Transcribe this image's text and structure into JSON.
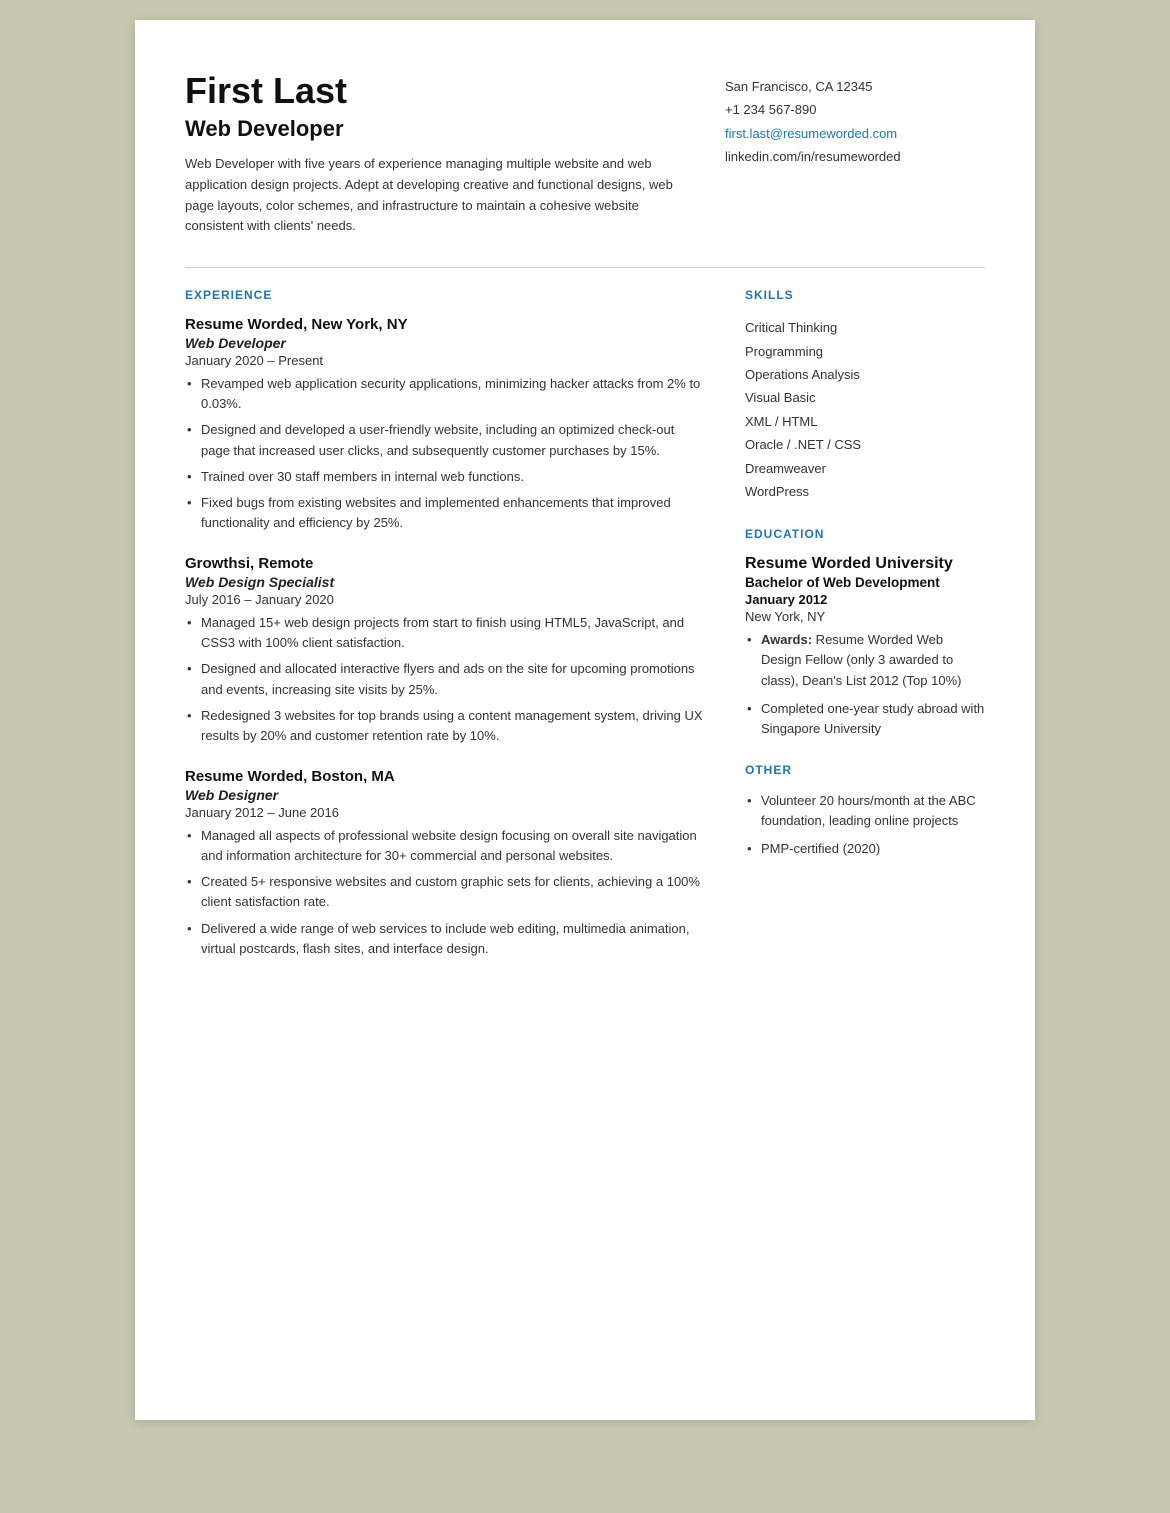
{
  "header": {
    "name": "First Last",
    "title": "Web Developer",
    "summary": "Web Developer with five years of experience managing multiple website and web application design projects. Adept at developing creative and functional designs, web page layouts, color schemes, and infrastructure to maintain a cohesive website consistent with clients' needs.",
    "contact": {
      "location": "San Francisco, CA 12345",
      "phone": "+1 234 567-890",
      "email": "first.last@resumeworded.com",
      "linkedin": "linkedin.com/in/resumeworded"
    }
  },
  "sections": {
    "experience_label": "EXPERIENCE",
    "skills_label": "SKILLS",
    "education_label": "EDUCATION",
    "other_label": "OTHER"
  },
  "experience": [
    {
      "company": "Resume Worded",
      "location": "New York, NY",
      "job_title": "Web Developer",
      "dates": "January 2020 – Present",
      "bullets": [
        "Revamped web application security applications, minimizing hacker attacks from 2% to 0.03%.",
        "Designed and developed a user-friendly website, including an optimized check-out page that increased user clicks, and subsequently customer purchases by 15%.",
        "Trained over 30 staff members in internal web functions.",
        "Fixed bugs from existing websites and implemented enhancements that improved functionality and efficiency by 25%."
      ]
    },
    {
      "company": "Growthsi",
      "location": "Remote",
      "job_title": "Web Design Specialist",
      "dates": "July 2016 – January 2020",
      "bullets": [
        "Managed 15+ web design projects from start to finish using HTML5, JavaScript, and CSS3 with 100% client satisfaction.",
        "Designed and allocated interactive flyers and ads on the site for upcoming promotions and events, increasing site visits by 25%.",
        "Redesigned 3 websites for top brands using a content management system, driving UX results by 20% and customer retention rate by 10%."
      ]
    },
    {
      "company": "Resume Worded",
      "location": "Boston, MA",
      "job_title": "Web Designer",
      "dates": "January 2012 – June 2016",
      "bullets": [
        "Managed all aspects of professional website design focusing on overall site navigation and information architecture for 30+ commercial and personal websites.",
        "Created 5+ responsive websites and custom graphic sets for clients, achieving a 100% client satisfaction rate.",
        "Delivered a wide range of web services to include web editing, multimedia animation, virtual postcards, flash sites, and interface design."
      ]
    }
  ],
  "skills": [
    "Critical Thinking",
    "Programming",
    "Operations Analysis",
    "Visual Basic",
    "XML / HTML",
    "Oracle / .NET / CSS",
    "Dreamweaver",
    "WordPress"
  ],
  "education": {
    "school": "Resume Worded University",
    "degree": "Bachelor of Web Development",
    "date": "January 2012",
    "location": "New York, NY",
    "bullets": [
      {
        "bold": "Awards:",
        "text": " Resume Worded Web Design Fellow (only 3 awarded to class), Dean's List 2012 (Top 10%)"
      },
      {
        "bold": "",
        "text": "Completed one-year study abroad with Singapore University"
      }
    ]
  },
  "other": [
    "Volunteer 20 hours/month at the ABC foundation, leading online projects",
    "PMP-certified (2020)"
  ]
}
